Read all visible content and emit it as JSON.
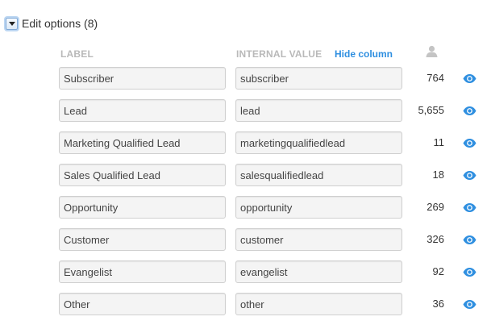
{
  "header": {
    "title": "Edit options (8)",
    "toggle_icon": "caret-down-icon"
  },
  "columns": {
    "label": "LABEL",
    "internal_value": "INTERNAL VALUE",
    "hide_column": "Hide column",
    "count_icon": "user-icon"
  },
  "colors": {
    "accent": "#2f8fe0",
    "column_header": "#b9b9b9",
    "field_bg": "#f4f4f4"
  },
  "rows": [
    {
      "label": "Subscriber",
      "value": "subscriber",
      "count": "764",
      "visibility_icon": "eye-icon"
    },
    {
      "label": "Lead",
      "value": "lead",
      "count": "5,655",
      "visibility_icon": "eye-icon"
    },
    {
      "label": "Marketing Qualified Lead",
      "value": "marketingqualifiedlead",
      "count": "11",
      "visibility_icon": "eye-icon"
    },
    {
      "label": "Sales Qualified Lead",
      "value": "salesqualifiedlead",
      "count": "18",
      "visibility_icon": "eye-icon"
    },
    {
      "label": "Opportunity",
      "value": "opportunity",
      "count": "269",
      "visibility_icon": "eye-icon"
    },
    {
      "label": "Customer",
      "value": "customer",
      "count": "326",
      "visibility_icon": "eye-icon"
    },
    {
      "label": "Evangelist",
      "value": "evangelist",
      "count": "92",
      "visibility_icon": "eye-icon"
    },
    {
      "label": "Other",
      "value": "other",
      "count": "36",
      "visibility_icon": "eye-icon"
    }
  ]
}
